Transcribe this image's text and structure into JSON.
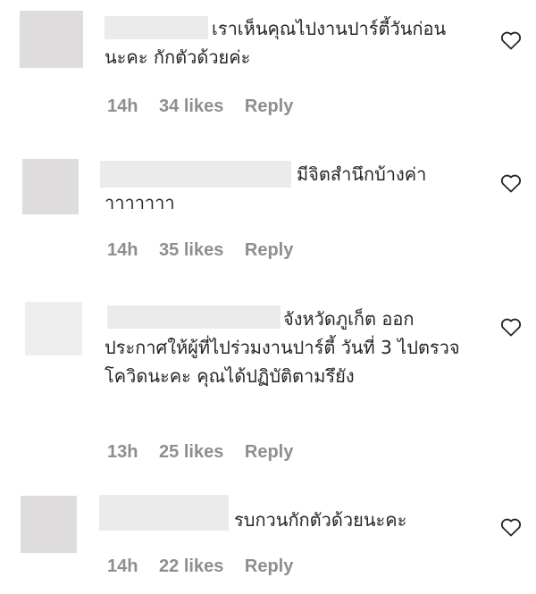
{
  "comments": [
    {
      "text": "เราเห็นคุณไปงานปาร์ตี้วันก่อนนะคะ กักตัวด้วยค่ะ",
      "time": "14h",
      "likes": "34 likes",
      "reply": "Reply"
    },
    {
      "text": "มีจิตสำนึกบ้างค่าาาาาาาา",
      "time": "14h",
      "likes": "35 likes",
      "reply": "Reply"
    },
    {
      "text": "จังหวัดภูเก็ต ออกประกาศให้ผู้ที่ไปร่วมงานปาร์ตี้ วันที่ 3 ไปตรวจโควิดนะคะ คุณได้ปฏิบัติตามรึยัง",
      "time": "13h",
      "likes": "25 likes",
      "reply": "Reply"
    },
    {
      "text": "รบกวนกักตัวด้วยนะคะ",
      "time": "14h",
      "likes": "22 likes",
      "reply": "Reply"
    }
  ],
  "icons": {
    "like": "heart-icon"
  },
  "colors": {
    "meta": "#8e8e8e",
    "text": "#262626",
    "placeholder": "#dedcdc"
  }
}
